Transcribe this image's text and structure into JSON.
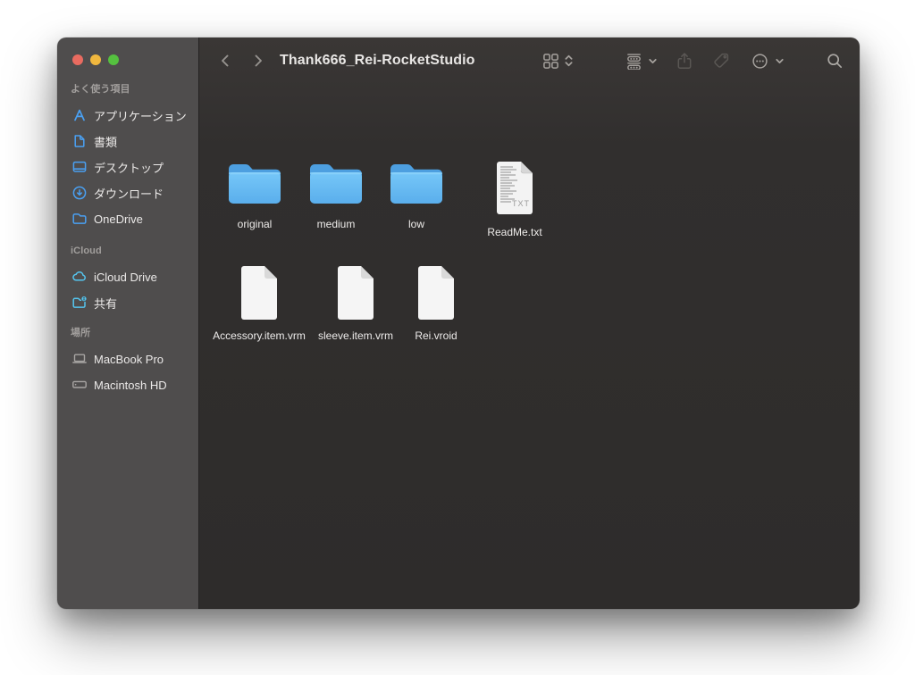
{
  "window": {
    "title": "Thank666_Rei-RocketStudio",
    "kind": "macOS Finder (dark mode)"
  },
  "titlebar": {
    "traffic_lights": [
      {
        "name": "close",
        "color": "#e96b60"
      },
      {
        "name": "minimize",
        "color": "#f0b73e"
      },
      {
        "name": "zoom",
        "color": "#55c13f"
      }
    ]
  },
  "toolbar": {
    "back_icon": "chevron-left",
    "forward_icon": "chevron-right",
    "view_button_icon": "grid-view-icon with up-down chevrons",
    "group_button_icon": "group-by-icon with chevron-down",
    "share_button_icon": "share-icon (disabled)",
    "tag_button_icon": "tag-icon (disabled)",
    "more_button_icon": "ellipsis-circle-icon with chevron-down",
    "search_button_icon": "magnifier-icon"
  },
  "sidebar": {
    "sections": [
      {
        "label": "よく使う項目",
        "items": [
          {
            "label": "アプリケーション",
            "icon": "app-store-a-icon",
            "color": "#4aa0f2"
          },
          {
            "label": "書類",
            "icon": "document-icon",
            "color": "#4aa0f2"
          },
          {
            "label": "デスクトップ",
            "icon": "desktop-icon",
            "color": "#4aa0f2"
          },
          {
            "label": "ダウンロード",
            "icon": "download-circle-icon",
            "color": "#4aa0f2"
          },
          {
            "label": "OneDrive",
            "icon": "folder-icon",
            "color": "#4aa0f2"
          }
        ]
      },
      {
        "label": "iCloud",
        "items": [
          {
            "label": "iCloud Drive",
            "icon": "cloud-icon",
            "color": "#55c6f0"
          },
          {
            "label": "共有",
            "icon": "shared-folder-icon",
            "color": "#55c6f0"
          }
        ]
      },
      {
        "label": "場所",
        "items": [
          {
            "label": "MacBook Pro",
            "icon": "laptop-icon",
            "color": "#a8a5a3"
          },
          {
            "label": "Macintosh HD",
            "icon": "hard-drive-icon",
            "color": "#a8a5a3"
          }
        ]
      }
    ]
  },
  "files": [
    {
      "name": "original",
      "type": "folder"
    },
    {
      "name": "medium",
      "type": "folder"
    },
    {
      "name": "low",
      "type": "folder"
    },
    {
      "name": "ReadMe.txt",
      "type": "text-file",
      "badge": "TXT"
    },
    {
      "name": "Accessory.item.vrm",
      "type": "blank-file"
    },
    {
      "name": "sleeve.item.vrm",
      "type": "blank-file"
    },
    {
      "name": "Rei.vroid",
      "type": "blank-file"
    }
  ],
  "colors": {
    "page_background": "#ffffff",
    "sidebar_background": "#4f4d4d",
    "content_background": "#2e2c2b",
    "toolbar_background": "#373433",
    "divider": "#232222",
    "sidebar_accent_blue": "#4aa0f2",
    "icloud_cyan": "#55c6f0",
    "folder_face": "#6fc2f6",
    "folder_tab": "#4d9fe0",
    "label_text": "#edebea",
    "title_text": "#e8e6e4"
  }
}
